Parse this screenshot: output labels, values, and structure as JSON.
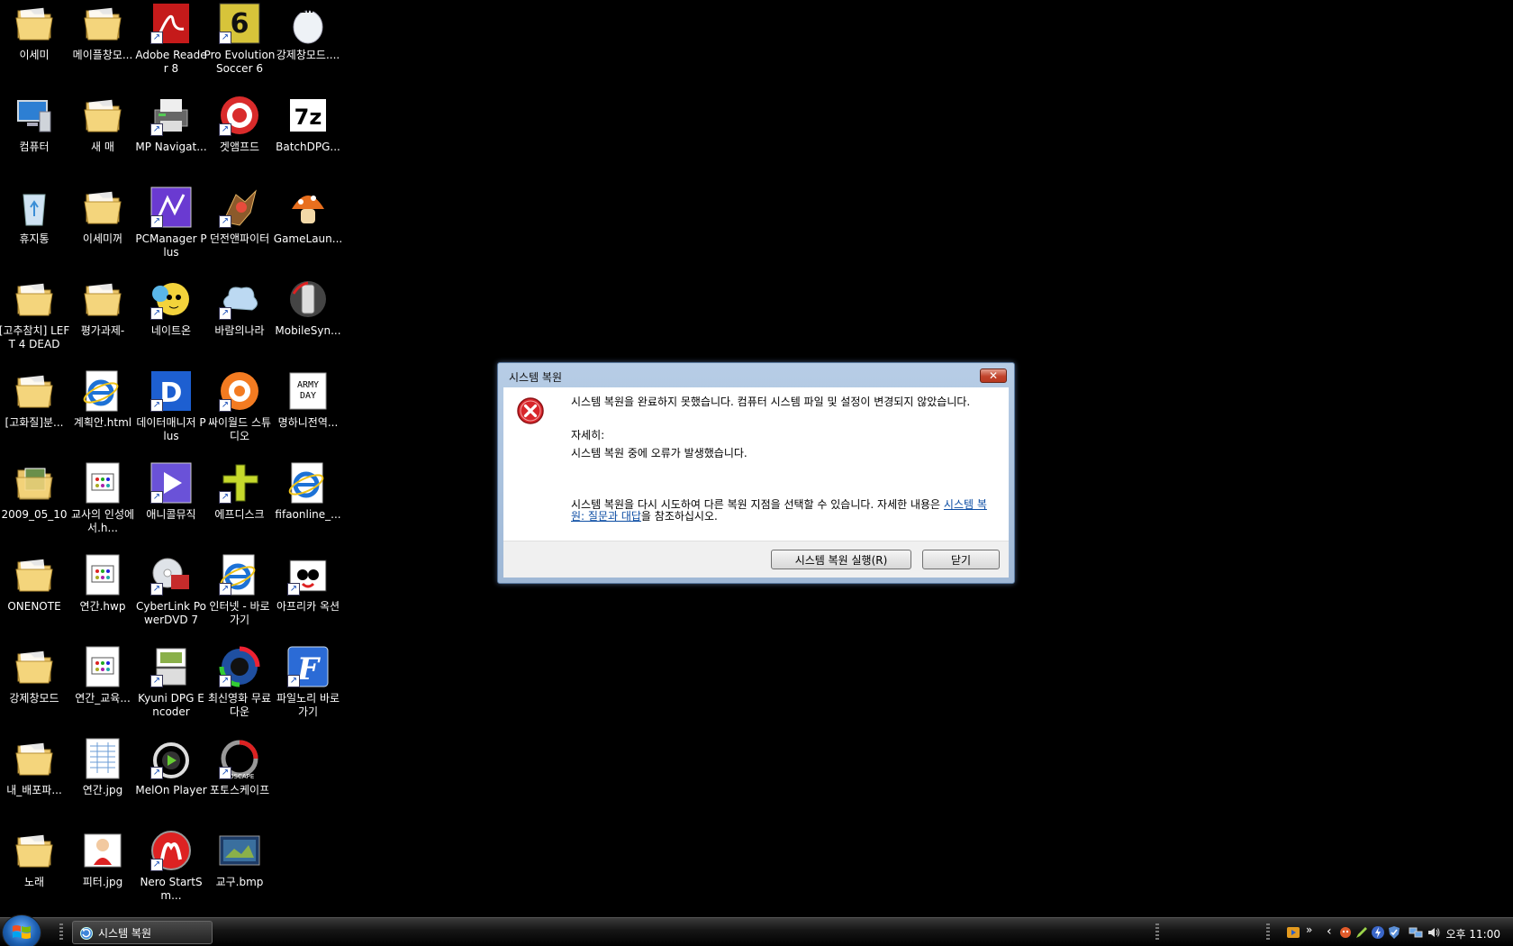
{
  "desktop": {
    "icons": [
      {
        "label": "이세미",
        "kind": "folder"
      },
      {
        "label": "메이플창모...",
        "kind": "folder"
      },
      {
        "label": "Adobe Reader 8",
        "kind": "pdf",
        "shortcut": true
      },
      {
        "label": "Pro Evolution Soccer 6",
        "kind": "game-6",
        "shortcut": true
      },
      {
        "label": "강제창모드....",
        "kind": "zip"
      },
      {
        "label": "컴퓨터",
        "kind": "computer"
      },
      {
        "label": "새 매",
        "kind": "folder"
      },
      {
        "label": "MP Navigat...",
        "kind": "printer",
        "shortcut": true
      },
      {
        "label": "겟앰프드",
        "kind": "target",
        "shortcut": true
      },
      {
        "label": "BatchDPG...",
        "kind": "7z"
      },
      {
        "label": "휴지통",
        "kind": "recycle"
      },
      {
        "label": "이세미꺼",
        "kind": "folder"
      },
      {
        "label": "PCManager Plus",
        "kind": "pcmanager",
        "shortcut": true
      },
      {
        "label": "던전앤파이터",
        "kind": "warrior",
        "shortcut": true
      },
      {
        "label": "GameLaun...",
        "kind": "mushroom"
      },
      {
        "label": "[고추참치] LEFT 4 DEAD",
        "kind": "folder"
      },
      {
        "label": "평가과제-",
        "kind": "folder"
      },
      {
        "label": "네이트온",
        "kind": "nateon",
        "shortcut": true
      },
      {
        "label": "바람의나라",
        "kind": "cloud",
        "shortcut": true
      },
      {
        "label": "MobileSyn...",
        "kind": "mobile"
      },
      {
        "label": "[고화질]분...",
        "kind": "folder"
      },
      {
        "label": "계획안.html",
        "kind": "ie"
      },
      {
        "label": "데이터매니저 Plus",
        "kind": "d-app",
        "shortcut": true
      },
      {
        "label": "싸이월드 스튜디오",
        "kind": "cyworld",
        "shortcut": true
      },
      {
        "label": "명하니전역...",
        "kind": "army"
      },
      {
        "label": "2009_05_10",
        "kind": "folder-img"
      },
      {
        "label": "교사의 인성에서.h...",
        "kind": "hwp"
      },
      {
        "label": "애니콜뮤직",
        "kind": "play",
        "shortcut": true
      },
      {
        "label": "에프디스크",
        "kind": "fdisk",
        "shortcut": true
      },
      {
        "label": "fifaonline_...",
        "kind": "ie"
      },
      {
        "label": "ONENOTE",
        "kind": "folder"
      },
      {
        "label": "연간.hwp",
        "kind": "hwp"
      },
      {
        "label": "CyberLink PowerDVD 7",
        "kind": "dvd",
        "shortcut": true
      },
      {
        "label": "인터넷 - 바로 가기",
        "kind": "ie",
        "shortcut": true
      },
      {
        "label": "아프리카 옥션",
        "kind": "tv",
        "shortcut": true
      },
      {
        "label": "강제창모드",
        "kind": "folder"
      },
      {
        "label": "연간_교육...",
        "kind": "hwp"
      },
      {
        "label": "Kyuni DPG Encoder",
        "kind": "dpg",
        "shortcut": true
      },
      {
        "label": "최신영화 무료다운",
        "kind": "film",
        "shortcut": true
      },
      {
        "label": "파일노리 바로가기",
        "kind": "f-app",
        "shortcut": true
      },
      {
        "label": "내_배포파...",
        "kind": "folder"
      },
      {
        "label": "연간.jpg",
        "kind": "jpg-table"
      },
      {
        "label": "MelOn Player",
        "kind": "melon",
        "shortcut": true
      },
      {
        "label": "포토스케이프",
        "kind": "photoscape",
        "shortcut": true
      },
      {
        "label": "",
        "kind": "none"
      },
      {
        "label": "노래",
        "kind": "folder"
      },
      {
        "label": "피터.jpg",
        "kind": "jpg-person"
      },
      {
        "label": "Nero StartSm...",
        "kind": "nero",
        "shortcut": true
      },
      {
        "label": "교구.bmp",
        "kind": "bmp"
      },
      {
        "label": "",
        "kind": "none"
      }
    ]
  },
  "dialog": {
    "title": "시스템 복원",
    "message_main": "시스템 복원을 완료하지 못했습니다. 컴퓨터 시스템 파일 및 설정이 변경되지 않았습니다.",
    "details_label": "자세히:",
    "details_text": "시스템 복원 중에 오류가 발생했습니다.",
    "hint_prefix": "시스템 복원을 다시 시도하여 다른 복원 지점을 선택할 수 있습니다. 자세한 내용은 ",
    "hint_link": "시스템 복원: 질문과 대답",
    "hint_suffix": "을 참조하십시오.",
    "run_button": "시스템 복원 실행(R)",
    "close_button": "닫기",
    "close_x": "✕"
  },
  "taskbar": {
    "task_label": "시스템 복원",
    "tray_chevron": "»",
    "tray_arrow": "‹",
    "clock": "오후 11:00"
  },
  "colors": {
    "desktop_bg": "#000000",
    "link": "#0b4ca3",
    "error_red": "#d8262b"
  }
}
